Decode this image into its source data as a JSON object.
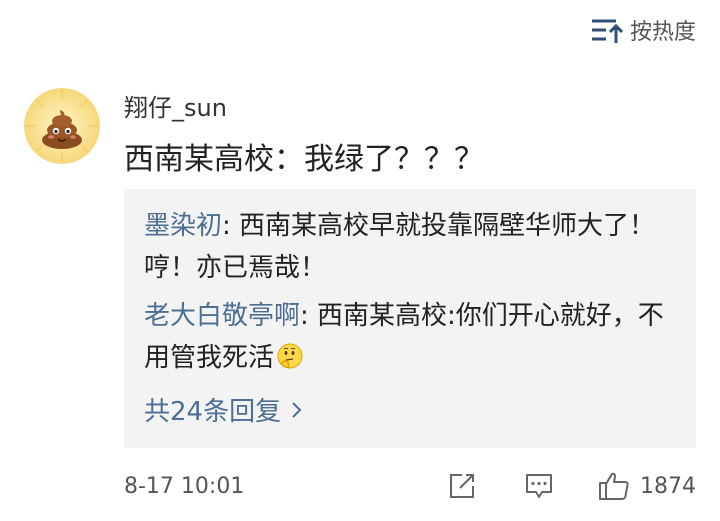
{
  "header": {
    "sort_label": "按热度",
    "sort_icon": "sort-lines-up-arrow-icon"
  },
  "comment": {
    "avatar_icon": "poop-emoji-avatar",
    "username": "翔仔_sun",
    "text": "西南某高校：我绿了？？？",
    "timestamp": "8-17 10:01",
    "like_count": "1874",
    "share_icon": "share-edit-icon",
    "reply_icon": "comment-bubble-icon",
    "like_icon": "thumbs-up-icon"
  },
  "replies": {
    "items": [
      {
        "author": "墨染初",
        "text": ": 西南某高校早就投靠隔壁华师大了！哼！亦已焉哉！"
      },
      {
        "author": "老大白敬亭啊",
        "text": ": 西南某高校:你们开心就好，不用管我死活",
        "emoji": "thinking-face-emoji"
      }
    ],
    "more_label": "共24条回复",
    "more_icon": "chevron-right-icon"
  },
  "colors": {
    "link_blue": "#4d6f94",
    "reply_bg": "#f3f3f3",
    "text_dark": "#222222",
    "text_gray": "#555555"
  }
}
